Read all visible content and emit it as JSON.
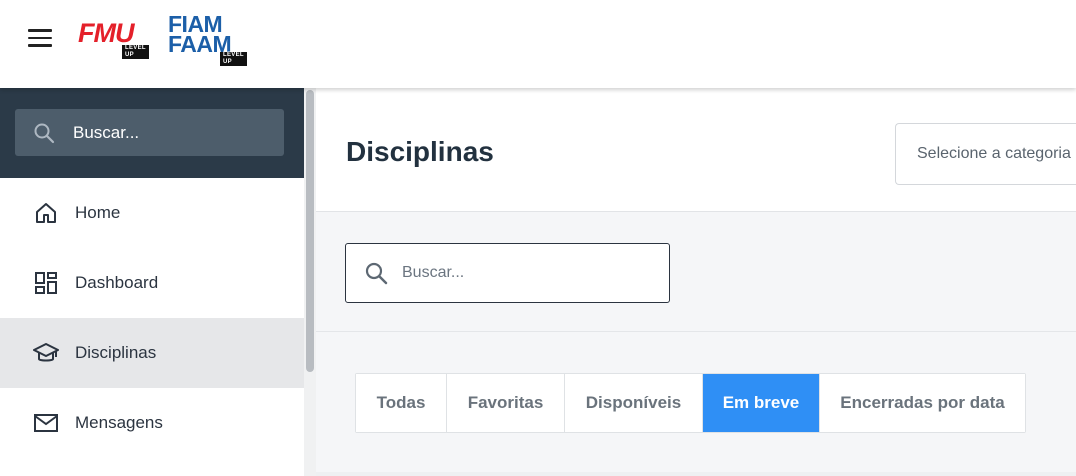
{
  "header": {
    "menu_icon": "hamburger-icon",
    "logo_fmu": {
      "text": "FMU",
      "tag": "LEVEL UP",
      "color": "#e4202a"
    },
    "logo_fiam": {
      "line1": "FIAM",
      "line2": "FAAM",
      "tag": "LEVEL UP",
      "color": "#1c5fa8"
    }
  },
  "sidebar": {
    "search": {
      "placeholder": "Buscar...",
      "icon": "search-icon"
    },
    "items": [
      {
        "label": "Home",
        "icon": "home-icon",
        "active": false
      },
      {
        "label": "Dashboard",
        "icon": "dashboard-icon",
        "active": false
      },
      {
        "label": "Disciplinas",
        "icon": "graduation-cap-icon",
        "active": true
      },
      {
        "label": "Mensagens",
        "icon": "envelope-icon",
        "active": false
      }
    ]
  },
  "main": {
    "title": "Disciplinas",
    "category_select": {
      "placeholder": "Selecione a categoria"
    },
    "search": {
      "placeholder": "Buscar...",
      "icon": "search-icon"
    },
    "tabs": [
      {
        "label": "Todas",
        "active": false
      },
      {
        "label": "Favoritas",
        "active": false
      },
      {
        "label": "Disponíveis",
        "active": false
      },
      {
        "label": "Em breve",
        "active": true
      },
      {
        "label": "Encerradas por data",
        "active": false
      }
    ]
  },
  "colors": {
    "accent": "#2f8ff5",
    "sidebar_dark": "#2b3a48",
    "active_item_bg": "#e6e7e9"
  }
}
